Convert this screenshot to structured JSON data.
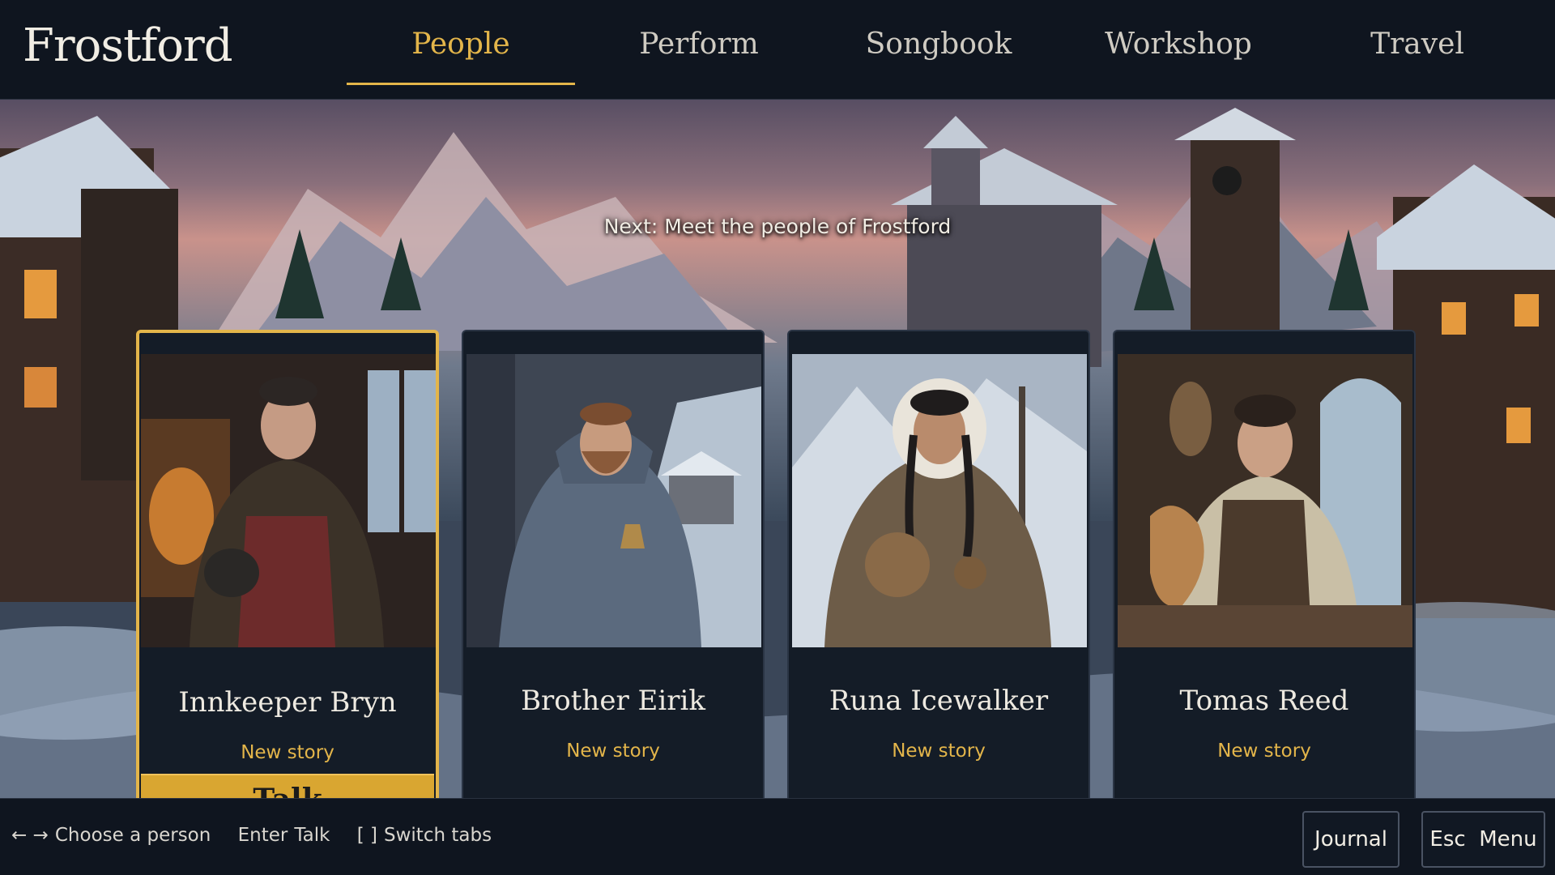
{
  "app": {
    "title": "Frostford"
  },
  "tabs": [
    {
      "label": "People",
      "active": true
    },
    {
      "label": "Perform",
      "active": false
    },
    {
      "label": "Songbook",
      "active": false
    },
    {
      "label": "Workshop",
      "active": false
    },
    {
      "label": "Travel",
      "active": false
    }
  ],
  "banner": "Next: Meet the people of Frostford",
  "cards": [
    {
      "name": "Innkeeper Bryn",
      "tag": "New story",
      "selected": true,
      "action": "Talk"
    },
    {
      "name": "Brother Eirik",
      "tag": "New story",
      "selected": false
    },
    {
      "name": "Runa Icewalker",
      "tag": "New story",
      "selected": false
    },
    {
      "name": "Tomas Reed",
      "tag": "New story",
      "selected": false
    }
  ],
  "footer": {
    "hints": [
      {
        "key": "← →",
        "label": "Choose a person"
      },
      {
        "key": "Enter",
        "label": "Talk"
      },
      {
        "key": "[ ]",
        "label": "Switch tabs"
      }
    ],
    "buttons": {
      "journal": "Journal",
      "menu": "Esc  Menu"
    }
  },
  "colors": {
    "accent": "#e3b54a",
    "bar": "#0f151f",
    "card": "#141c27"
  }
}
